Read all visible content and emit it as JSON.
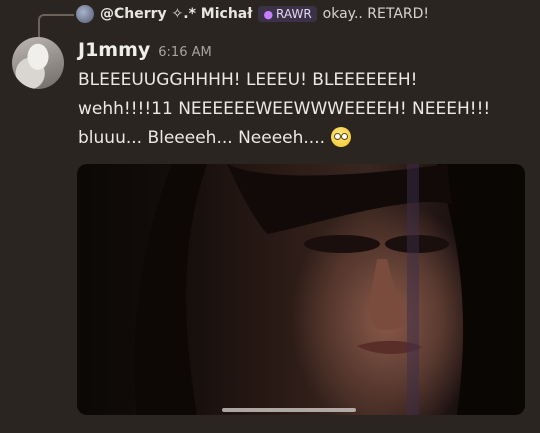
{
  "reply": {
    "author": "@Cherry ✧.* Michał",
    "role_tag": "RAWR",
    "preview": "okay.. RETARD!"
  },
  "message": {
    "author": "J1mmy",
    "time": "6:16 AM",
    "lines": [
      "BLEEEUUGGHHHH! LEEEU! BLEEEEEEH!",
      "wehh!!!!11 NEEEEEEWEEWWWEEEEH! NEEEH!!!",
      "bluuu...  Bleeeeh...  Neeeeh...."
    ],
    "emoji": "woozy-face-icon"
  },
  "attachment": {
    "type": "image",
    "subject": "photo of long-haired man"
  }
}
